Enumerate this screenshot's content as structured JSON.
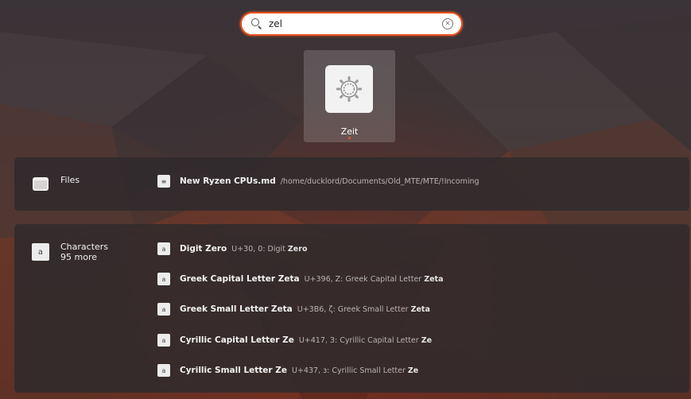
{
  "search": {
    "query": "zel",
    "clear_glyph": "✕"
  },
  "app_result": {
    "label": "Zeit",
    "icon": "gear-settings-icon"
  },
  "files": {
    "provider_name": "Files",
    "provider_icon": "folder-icon",
    "results": [
      {
        "icon": "text-file-icon",
        "icon_glyph": "≡",
        "name": "New Ryzen CPUs.md",
        "description": "/home/ducklord/Documents/Old_MTE/MTE/!Incoming"
      }
    ]
  },
  "characters": {
    "provider_name": "Characters",
    "more_label": "95 more",
    "provider_icon": "character-a-icon",
    "provider_glyph": "a",
    "results": [
      {
        "glyph": "a",
        "name": "Digit Zero",
        "desc_prefix": "U+30, 0: ",
        "desc_plain": "Digit ",
        "desc_bold": "Zero"
      },
      {
        "glyph": "a",
        "name": "Greek Capital Letter Zeta",
        "desc_prefix": "U+396, Z: ",
        "desc_plain": "Greek Capital Letter ",
        "desc_bold": "Zeta"
      },
      {
        "glyph": "a",
        "name": "Greek Small Letter Zeta",
        "desc_prefix": "U+3B6, ζ: ",
        "desc_plain": "Greek Small Letter ",
        "desc_bold": "Zeta"
      },
      {
        "glyph": "a",
        "name": "Cyrillic Capital Letter Ze",
        "desc_prefix": "U+417, З: ",
        "desc_plain": "Cyrillic Capital Letter ",
        "desc_bold": "Ze"
      },
      {
        "glyph": "a",
        "name": "Cyrillic Small Letter Ze",
        "desc_prefix": "U+437, з: ",
        "desc_plain": "Cyrillic Small Letter ",
        "desc_bold": "Ze"
      }
    ]
  },
  "colors": {
    "accent": "#e95420",
    "panel_bg": "#302a2c",
    "tile_bg": "#5e5758"
  }
}
